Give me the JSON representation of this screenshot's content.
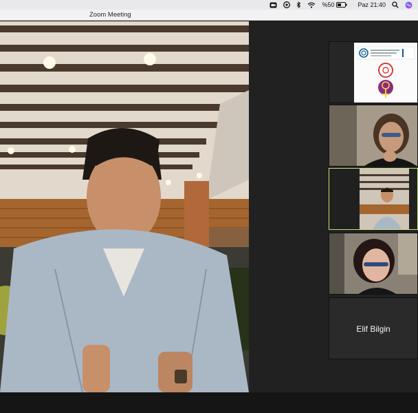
{
  "menubar": {
    "battery_label": "%50",
    "clock": "Paz 21:40",
    "icons": [
      "zoom-status-icon",
      "screen-sharing-icon",
      "bluetooth-icon",
      "wifi-icon",
      "battery-icon",
      "search-icon",
      "siri-icon"
    ]
  },
  "window": {
    "title": "Zoom Meeting"
  },
  "participants": {
    "speaker": {
      "role": "active-speaker"
    },
    "gallery": [
      {
        "type": "logos"
      },
      {
        "type": "video"
      },
      {
        "type": "video",
        "active": true
      },
      {
        "type": "video"
      },
      {
        "type": "name-only",
        "name": "Elif Bilgin"
      }
    ]
  },
  "colors": {
    "active_border": "#c6e37a",
    "background": "#212121",
    "titlebar": "#f2f2f2"
  }
}
